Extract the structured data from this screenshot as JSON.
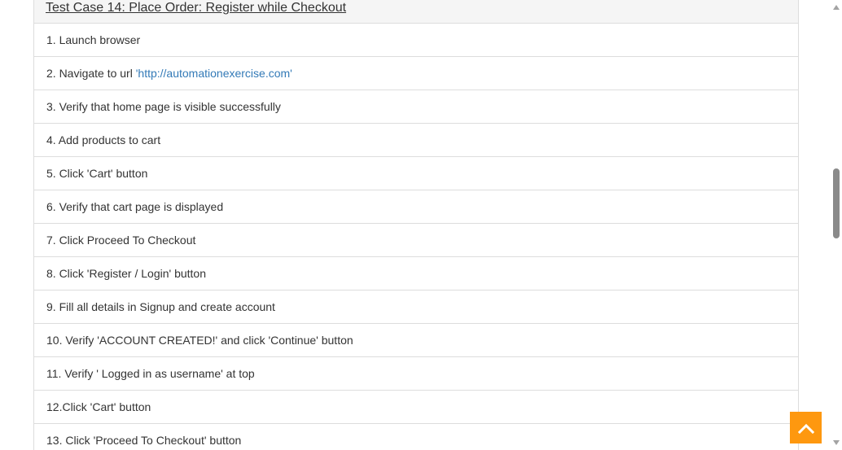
{
  "test_case": {
    "title": "Test Case 14: Place Order: Register while Checkout",
    "steps": [
      {
        "prefix": "1. Launch browser"
      },
      {
        "prefix": "2. Navigate to url ",
        "link": "'http://automationexercise.com'"
      },
      {
        "prefix": "3. Verify that home page is visible successfully"
      },
      {
        "prefix": "4. Add products to cart"
      },
      {
        "prefix": "5. Click 'Cart' button"
      },
      {
        "prefix": "6. Verify that cart page is displayed"
      },
      {
        "prefix": "7. Click Proceed To Checkout"
      },
      {
        "prefix": "8. Click 'Register / Login' button"
      },
      {
        "prefix": "9. Fill all details in Signup and create account"
      },
      {
        "prefix": "10. Verify 'ACCOUNT CREATED!' and click 'Continue' button"
      },
      {
        "prefix": "11. Verify ' Logged in as username' at top"
      },
      {
        "prefix": "12.Click 'Cart' button"
      },
      {
        "prefix": "13. Click 'Proceed To Checkout' button"
      }
    ]
  },
  "scroll_up_button": {
    "icon": "chevron-up-icon",
    "color": "#fe980f"
  },
  "colors": {
    "link": "#337ab7",
    "text": "#333333",
    "border": "#dddddd",
    "heading_bg": "#f5f5f5"
  }
}
